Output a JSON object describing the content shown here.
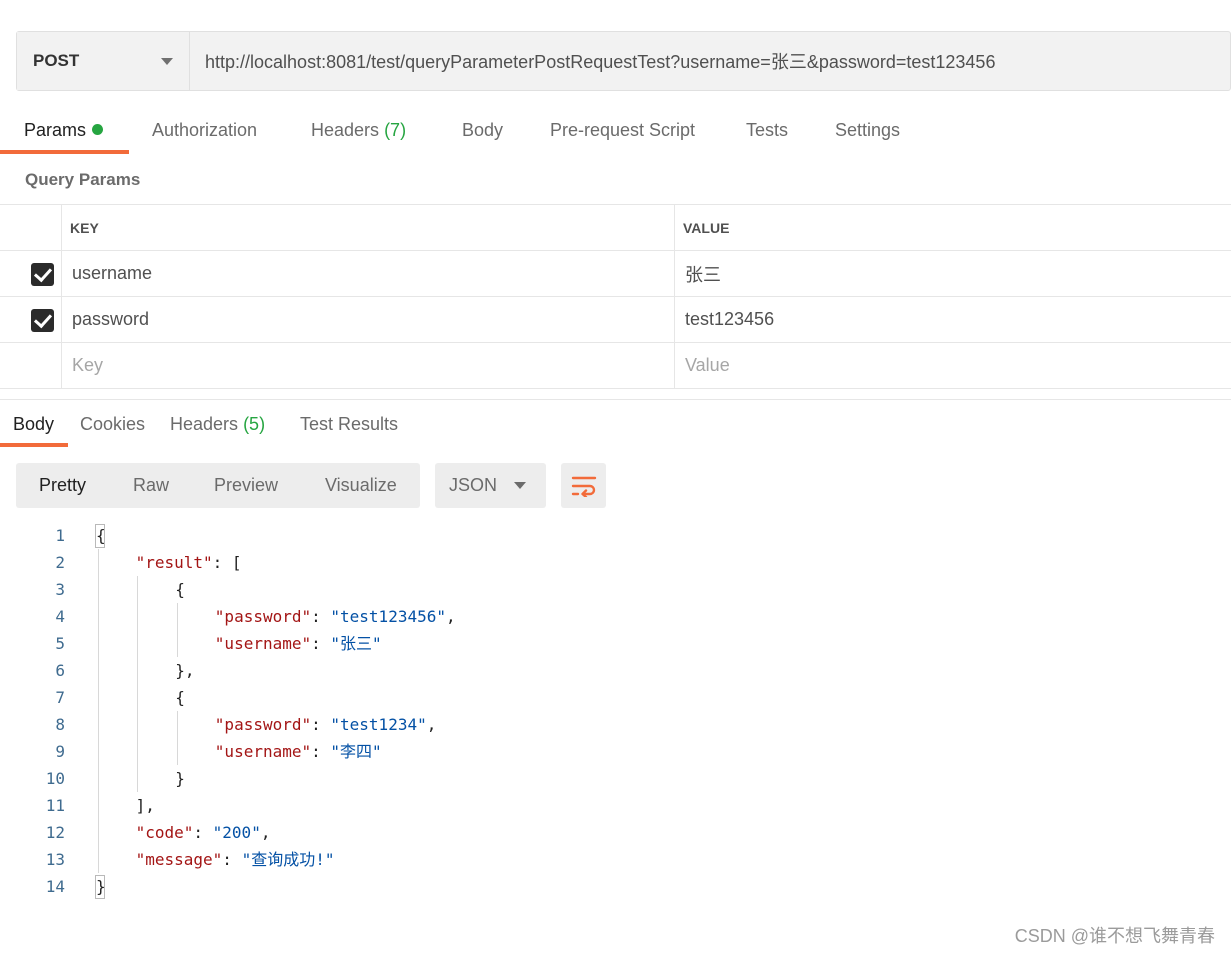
{
  "request": {
    "method": "POST",
    "url": "http://localhost:8081/test/queryParameterPostRequestTest?username=张三&password=test123456"
  },
  "request_tabs": [
    {
      "label": "Params"
    },
    {
      "label": "Authorization"
    },
    {
      "label": "Headers",
      "count": "(7)"
    },
    {
      "label": "Body"
    },
    {
      "label": "Pre-request Script"
    },
    {
      "label": "Tests"
    },
    {
      "label": "Settings"
    }
  ],
  "query_params": {
    "title": "Query Params",
    "headers": {
      "key": "KEY",
      "value": "VALUE"
    },
    "rows": [
      {
        "key": "username",
        "value": "张三"
      },
      {
        "key": "password",
        "value": "test123456"
      }
    ],
    "placeholder": {
      "key": "Key",
      "value": "Value"
    }
  },
  "response_tabs": [
    {
      "label": "Body"
    },
    {
      "label": "Cookies"
    },
    {
      "label": "Headers",
      "count": "(5)"
    },
    {
      "label": "Test Results"
    }
  ],
  "view_modes": [
    "Pretty",
    "Raw",
    "Preview",
    "Visualize"
  ],
  "format": "JSON",
  "code_lines": [
    {
      "n": "1",
      "indent": 0,
      "parts": [
        [
          "p",
          "{"
        ]
      ]
    },
    {
      "n": "2",
      "indent": 1,
      "parts": [
        [
          "k",
          "\"result\""
        ],
        [
          "p",
          ": ["
        ]
      ]
    },
    {
      "n": "3",
      "indent": 2,
      "parts": [
        [
          "p",
          "{"
        ]
      ]
    },
    {
      "n": "4",
      "indent": 3,
      "parts": [
        [
          "k",
          "\"password\""
        ],
        [
          "p",
          ": "
        ],
        [
          "s",
          "\"test123456\""
        ],
        [
          "p",
          ","
        ]
      ]
    },
    {
      "n": "5",
      "indent": 3,
      "parts": [
        [
          "k",
          "\"username\""
        ],
        [
          "p",
          ": "
        ],
        [
          "s",
          "\"张三\""
        ]
      ]
    },
    {
      "n": "6",
      "indent": 2,
      "parts": [
        [
          "p",
          "},"
        ]
      ]
    },
    {
      "n": "7",
      "indent": 2,
      "parts": [
        [
          "p",
          "{"
        ]
      ]
    },
    {
      "n": "8",
      "indent": 3,
      "parts": [
        [
          "k",
          "\"password\""
        ],
        [
          "p",
          ": "
        ],
        [
          "s",
          "\"test1234\""
        ],
        [
          "p",
          ","
        ]
      ]
    },
    {
      "n": "9",
      "indent": 3,
      "parts": [
        [
          "k",
          "\"username\""
        ],
        [
          "p",
          ": "
        ],
        [
          "s",
          "\"李四\""
        ]
      ]
    },
    {
      "n": "10",
      "indent": 2,
      "parts": [
        [
          "p",
          "}"
        ]
      ]
    },
    {
      "n": "11",
      "indent": 1,
      "parts": [
        [
          "p",
          "],"
        ]
      ]
    },
    {
      "n": "12",
      "indent": 1,
      "parts": [
        [
          "k",
          "\"code\""
        ],
        [
          "p",
          ": "
        ],
        [
          "s",
          "\"200\""
        ],
        [
          "p",
          ","
        ]
      ]
    },
    {
      "n": "13",
      "indent": 1,
      "parts": [
        [
          "k",
          "\"message\""
        ],
        [
          "p",
          ": "
        ],
        [
          "s",
          "\"查询成功!\""
        ]
      ]
    },
    {
      "n": "14",
      "indent": 0,
      "parts": [
        [
          "p",
          "}"
        ]
      ]
    }
  ],
  "watermark": "CSDN @谁不想飞舞青春",
  "colors": {
    "accent": "#f26b3a",
    "count_green": "#26a541",
    "json_key": "#a31515",
    "json_string": "#0451a5"
  }
}
